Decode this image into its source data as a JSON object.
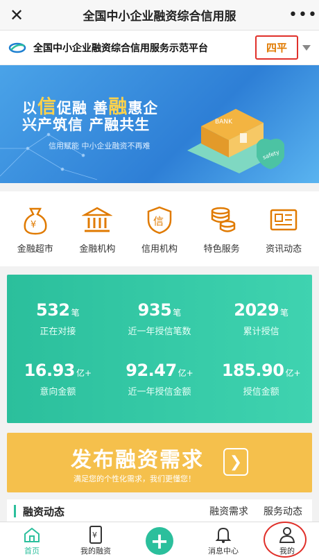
{
  "titlebar": {
    "title": "全国中小企业融资综合信用服",
    "close_icon": "close-icon",
    "more_icon": "more-dots-icon"
  },
  "platform": {
    "name": "全国中小企业融资综合信用服务示范平台",
    "city": "四平"
  },
  "banner": {
    "line1_a": "以",
    "line1_b": "信",
    "line1_c": "促融  善",
    "line1_d": "融",
    "line1_e": "惠企",
    "line2": "兴产筑信  产融共生",
    "sub": "信用赋能   中小企业融资不再难",
    "bank_label": "BANK",
    "safety_label": "safety"
  },
  "quicknav": [
    {
      "label": "金融超市",
      "icon": "money-bag-icon"
    },
    {
      "label": "金融机构",
      "icon": "bank-building-icon"
    },
    {
      "label": "信用机构",
      "icon": "credit-shield-icon"
    },
    {
      "label": "特色服务",
      "icon": "coin-stack-icon"
    },
    {
      "label": "资讯动态",
      "icon": "news-icon"
    }
  ],
  "stats": [
    {
      "num": "532",
      "unit": "笔",
      "label": "正在对接"
    },
    {
      "num": "935",
      "unit": "笔",
      "label": "近一年授信笔数"
    },
    {
      "num": "2029",
      "unit": "笔",
      "label": "累计授信"
    },
    {
      "num": "16.93",
      "unit": "亿+",
      "label": "意向金额"
    },
    {
      "num": "92.47",
      "unit": "亿+",
      "label": "近一年授信金额"
    },
    {
      "num": "185.90",
      "unit": "亿+",
      "label": "授信金额"
    }
  ],
  "publish": {
    "title": "发布融资需求",
    "subtitle": "满足您的个性化需求，我们更懂您！"
  },
  "finnews": {
    "title": "融资动态",
    "tabs": [
      "融资需求",
      "服务动态"
    ]
  },
  "tabbar": [
    {
      "label": "首页",
      "icon": "home-icon"
    },
    {
      "label": "我的融资",
      "icon": "phone-yen-icon"
    },
    {
      "label": "",
      "icon": "plus-icon"
    },
    {
      "label": "消息中心",
      "icon": "bell-icon"
    },
    {
      "label": "我的",
      "icon": "user-icon"
    }
  ],
  "colors": {
    "accent": "#2bbf9c",
    "orange": "#e07a00",
    "highlight_red": "#e0302a",
    "publish_bg": "#f5c04c"
  }
}
